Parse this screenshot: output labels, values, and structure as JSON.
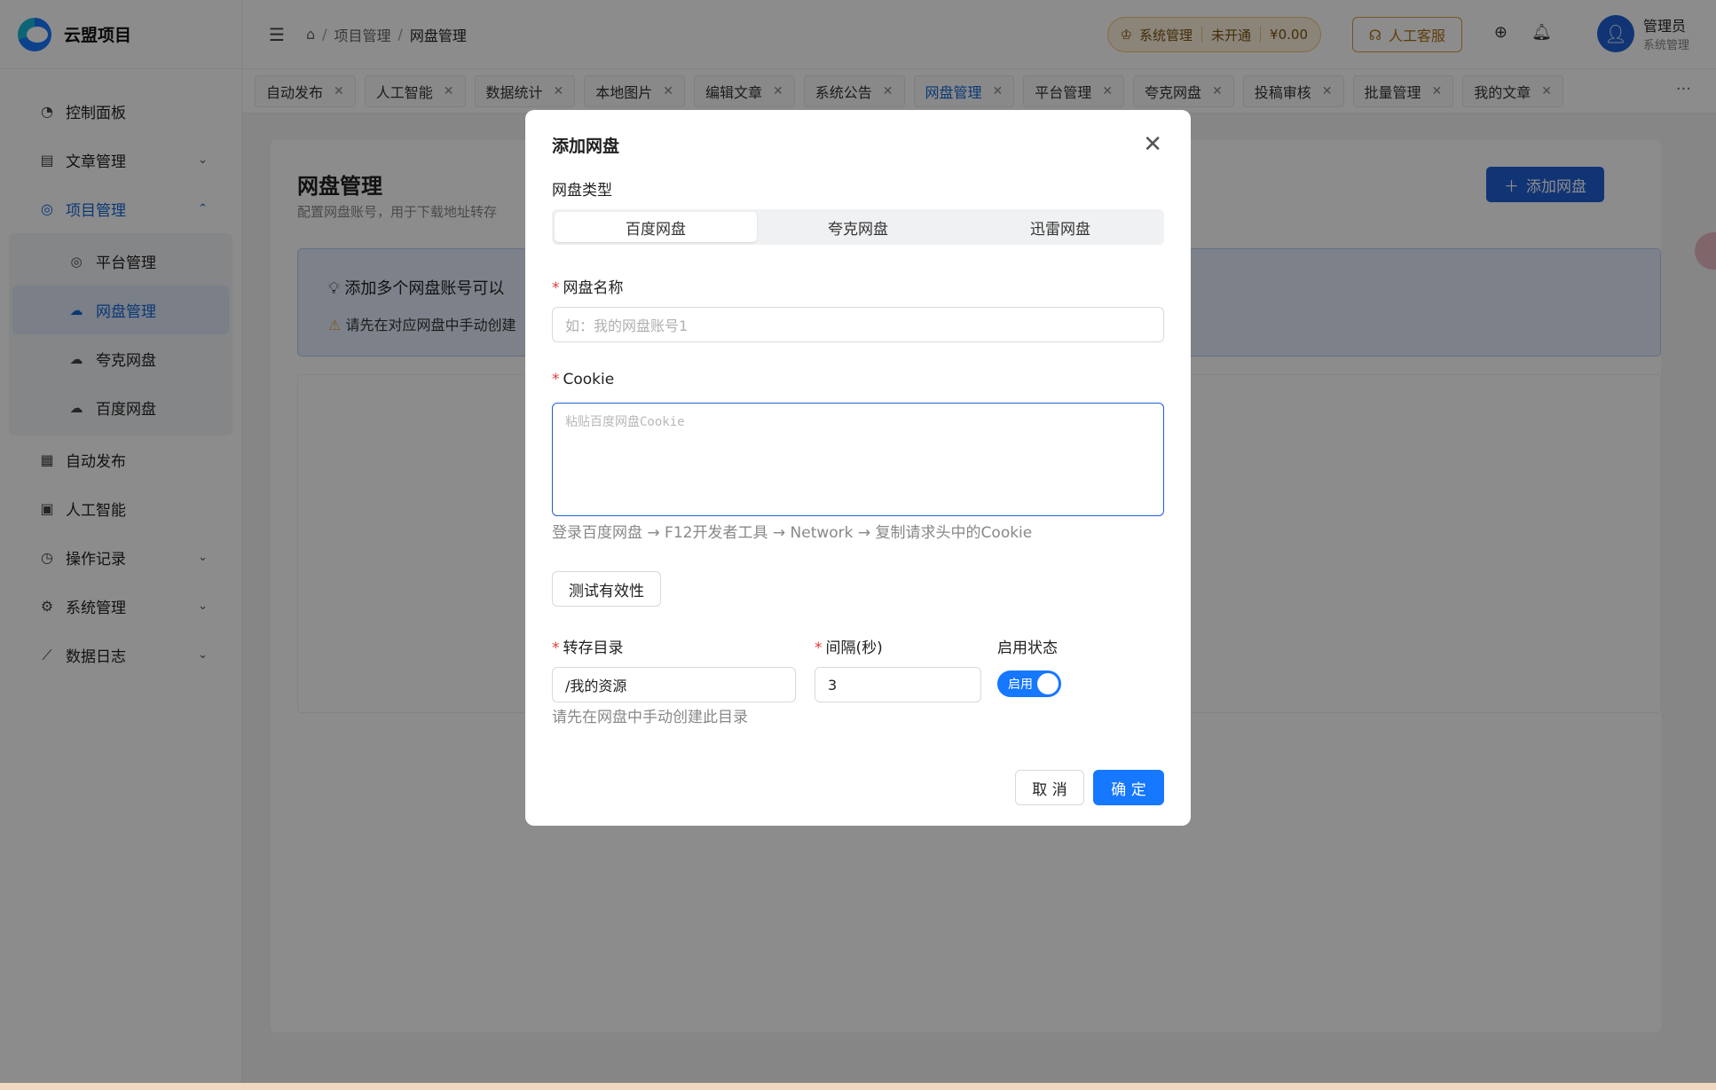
{
  "app": {
    "name": "云盟项目"
  },
  "sidebar": {
    "items": [
      {
        "label": "控制面板",
        "icon": "gauge-icon"
      },
      {
        "label": "文章管理",
        "icon": "document-icon",
        "chevron": "down"
      },
      {
        "label": "项目管理",
        "icon": "project-icon",
        "chevron": "up"
      },
      {
        "label": "自动发布",
        "icon": "calendar-icon"
      },
      {
        "label": "人工智能",
        "icon": "ai-icon"
      },
      {
        "label": "操作记录",
        "icon": "history-icon",
        "chevron": "down"
      },
      {
        "label": "系统管理",
        "icon": "gear-icon",
        "chevron": "down"
      },
      {
        "label": "数据日志",
        "icon": "chart-icon",
        "chevron": "down"
      }
    ],
    "sub_items": [
      {
        "label": "平台管理"
      },
      {
        "label": "网盘管理"
      },
      {
        "label": "夸克网盘"
      },
      {
        "label": "百度网盘"
      }
    ]
  },
  "breadcrumb": [
    "项目管理",
    "网盘管理"
  ],
  "header": {
    "sys_label": "系统管理",
    "sys_status": "未开通",
    "sys_balance": "¥0.00",
    "support_label": "人工客服",
    "user_name": "管理员",
    "user_role": "系统管理"
  },
  "tabs": [
    "自动发布",
    "人工智能",
    "数据统计",
    "本地图片",
    "编辑文章",
    "系统公告",
    "网盘管理",
    "平台管理",
    "夸克网盘",
    "投稿审核",
    "批量管理",
    "我的文章"
  ],
  "active_tab": "网盘管理",
  "page": {
    "title": "网盘管理",
    "desc": "配置网盘账号，用于下载地址转存",
    "add_button": "添加网盘",
    "info_line1": "添加多个网盘账号可以",
    "info_line2": "请先在对应网盘中手动创建"
  },
  "modal": {
    "title": "添加网盘",
    "type_label": "网盘类型",
    "types": [
      "百度网盘",
      "夸克网盘",
      "迅雷网盘"
    ],
    "selected_type": "百度网盘",
    "name_label": "网盘名称",
    "name_placeholder": "如：我的网盘账号1",
    "cookie_label": "Cookie",
    "cookie_placeholder": "粘贴百度网盘Cookie",
    "cookie_help": "登录百度网盘 → F12开发者工具 → Network → 复制请求头中的Cookie",
    "test_button": "测试有效性",
    "dir_label": "转存目录",
    "dir_value": "/我的资源",
    "dir_help": "请先在网盘中手动创建此目录",
    "interval_label": "间隔(秒)",
    "interval_value": "3",
    "status_label": "启用状态",
    "status_switch": "启用",
    "cancel": "取 消",
    "ok": "确 定"
  },
  "colors": {
    "primary": "#1677ff",
    "sidebar_active": "#1366d6"
  }
}
